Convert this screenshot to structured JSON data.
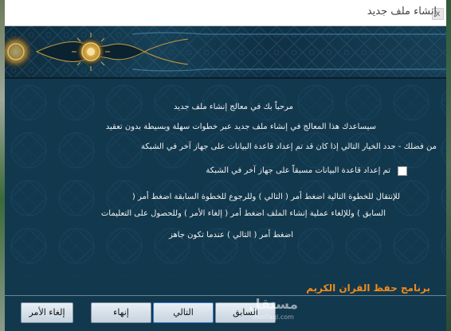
{
  "window": {
    "title": "إنشاء ملف جديد",
    "close_label": "x"
  },
  "content": {
    "welcome": "مرحباً بك في معالج إنشاء ملف جديد",
    "intro": "سيساعدك هذا المعالج في إنشاء ملف جديد عبر خطوات سهلة وبسيطة بدون تعقيد",
    "hint": "من فضلك - حدد الخيار التالي إذا كان قد تم إعداد قاعدة البيانات على جهاز آخر في الشبكة",
    "checkbox_label": "تم إعداد قاعدة البيانات مسبقاً على جهاز آخر في الشبكة",
    "checkbox_checked": false,
    "instructions_line1": "للإنتقال للخطوة التالية  اضغط أمر ( التالي ) وللرجوع للخطوة السابقة اضغط أمر (",
    "instructions_line2": "السابق ) وللإلغاء عملية إنشاء الملف اضغط أمر ( إلغاء الأمر ) وللحصول على التعليمات",
    "instructions_line3": "اضغط أمر ( التالي ) عندما تكون جاهز"
  },
  "footer": {
    "program_name": "برنامج حفظ القران الكريم",
    "program_color": "#f08a1c"
  },
  "buttons": {
    "cancel": "إلغاء الأمر",
    "finish": "إنهاء",
    "next": "التالي",
    "back": "السابق"
  },
  "watermark": {
    "main": "مستقل",
    "sub": "mostaql.com"
  },
  "colors": {
    "dialog_bg": "#12384d",
    "button_focus": "#3a7bd5"
  }
}
